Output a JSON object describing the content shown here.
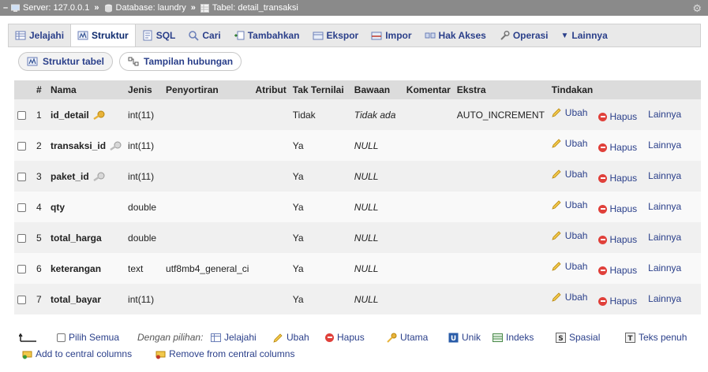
{
  "breadcrumb": {
    "server": "Server: 127.0.0.1",
    "database": "Database: laundry",
    "table": "Tabel: detail_transaksi",
    "separator": "»"
  },
  "tabs": [
    {
      "label": "Jelajahi",
      "icon": "browse-icon"
    },
    {
      "label": "Struktur",
      "icon": "structure-icon",
      "active": true
    },
    {
      "label": "SQL",
      "icon": "sql-icon"
    },
    {
      "label": "Cari",
      "icon": "search-icon"
    },
    {
      "label": "Tambahkan",
      "icon": "insert-icon"
    },
    {
      "label": "Ekspor",
      "icon": "export-icon"
    },
    {
      "label": "Impor",
      "icon": "import-icon"
    },
    {
      "label": "Hak Akses",
      "icon": "privileges-icon"
    },
    {
      "label": "Operasi",
      "icon": "wrench-icon"
    },
    {
      "label": "Lainnya",
      "icon": "chevron-down-icon"
    }
  ],
  "subtabs": [
    {
      "label": "Struktur tabel",
      "active": true
    },
    {
      "label": "Tampilan hubungan"
    }
  ],
  "table": {
    "headers": {
      "num": "#",
      "name": "Nama",
      "type": "Jenis",
      "collation": "Penyortiran",
      "attributes": "Atribut",
      "null": "Tak Ternilai",
      "default": "Bawaan",
      "comment": "Komentar",
      "extra": "Ekstra",
      "action": "Tindakan"
    },
    "rows": [
      {
        "num": "1",
        "name": "id_detail",
        "type": "int(11)",
        "collation": "",
        "attributes": "",
        "null": "Tidak",
        "default": "Tidak ada",
        "comment": "",
        "extra": "AUTO_INCREMENT",
        "key": "primary"
      },
      {
        "num": "2",
        "name": "transaksi_id",
        "type": "int(11)",
        "collation": "",
        "attributes": "",
        "null": "Ya",
        "default": "NULL",
        "comment": "",
        "extra": "",
        "key": "index"
      },
      {
        "num": "3",
        "name": "paket_id",
        "type": "int(11)",
        "collation": "",
        "attributes": "",
        "null": "Ya",
        "default": "NULL",
        "comment": "",
        "extra": "",
        "key": "index"
      },
      {
        "num": "4",
        "name": "qty",
        "type": "double",
        "collation": "",
        "attributes": "",
        "null": "Ya",
        "default": "NULL",
        "comment": "",
        "extra": "",
        "key": ""
      },
      {
        "num": "5",
        "name": "total_harga",
        "type": "double",
        "collation": "",
        "attributes": "",
        "null": "Ya",
        "default": "NULL",
        "comment": "",
        "extra": "",
        "key": ""
      },
      {
        "num": "6",
        "name": "keterangan",
        "type": "text",
        "collation": "utf8mb4_general_ci",
        "attributes": "",
        "null": "Ya",
        "default": "NULL",
        "comment": "",
        "extra": "",
        "key": ""
      },
      {
        "num": "7",
        "name": "total_bayar",
        "type": "int(11)",
        "collation": "",
        "attributes": "",
        "null": "Ya",
        "default": "NULL",
        "comment": "",
        "extra": "",
        "key": ""
      }
    ],
    "actions": {
      "edit": "Ubah",
      "drop": "Hapus",
      "more": "Lainnya"
    }
  },
  "footer": {
    "select_all": "Pilih Semua",
    "with_selected": "Dengan pilihan:",
    "browse": "Jelajahi",
    "edit": "Ubah",
    "drop": "Hapus",
    "primary": "Utama",
    "unique": "Unik",
    "index": "Indeks",
    "spatial": "Spasial",
    "fulltext": "Teks penuh",
    "add_central": "Add to central columns",
    "remove_central": "Remove from central columns"
  },
  "colors": {
    "link": "#2a3f8a",
    "header_bg": "#dcdcdc",
    "crumb_bg": "#8a8a8a",
    "drop_red": "#e0403a",
    "key_gold": "#e8b33a"
  }
}
